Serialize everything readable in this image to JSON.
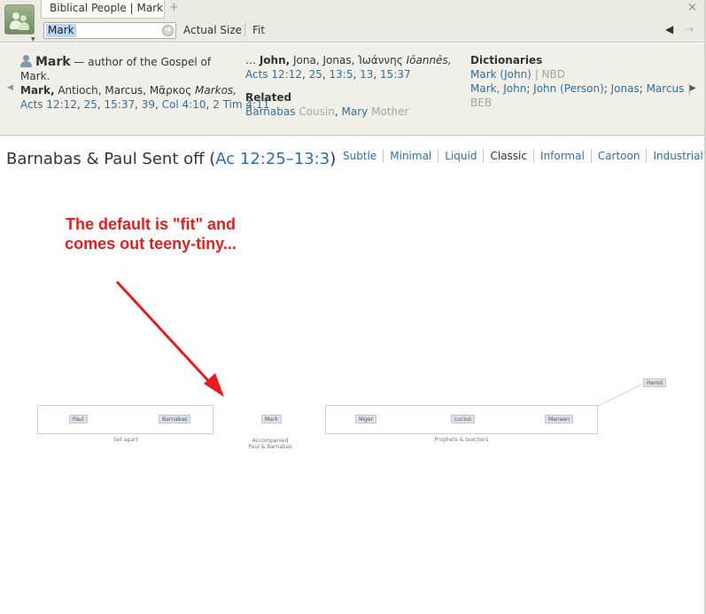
{
  "tab": {
    "title": "Biblical People | Mark",
    "new_tab": "+",
    "close": "×"
  },
  "toolbar": {
    "search_value": "Mark",
    "actual_size_label": "Actual Size",
    "fit_label": "Fit",
    "back_arrow": "◀",
    "forward_arrow": "⇢"
  },
  "info": {
    "name": "Mark",
    "description": "— author of the Gospel of Mark.",
    "alt_names_bold": "Mark,",
    "alt_names_plain": "Antioch, Marcus, Μᾶρκος",
    "alt_names_italic": "Markos,",
    "refs_col1": [
      "Acts 12:12",
      "25",
      "15:37",
      "39",
      "Col 4:10",
      "2 Tim 4:11"
    ],
    "col2_prefix": "…",
    "col2_bold": "John,",
    "col2_plain": "Jona, Jonas, Ἰωάννης",
    "col2_italic": "Iōannēs,",
    "refs_col2": [
      "Acts 12:12",
      "25",
      "13:5",
      "13",
      "15:37"
    ],
    "related_heading": "Related",
    "related": [
      {
        "name": "Barnabas",
        "relation": "Cousin"
      },
      {
        "name": "Mary",
        "relation": "Mother"
      }
    ],
    "dictionaries_heading": "Dictionaries",
    "dictionaries_line1": {
      "link": "Mark (John)",
      "muted": "| NBD"
    },
    "dictionaries_line2": [
      "Mark, John",
      "John (Person)",
      "Jonas",
      "Marcus"
    ],
    "dictionaries_line2_sep": "|",
    "dictionaries_line3_muted": "BEB"
  },
  "main": {
    "title_prefix": "Barnabas & Paul Sent off (",
    "title_ref": "Ac 12:25–13:3",
    "title_suffix": ")",
    "styles": [
      "Subtle",
      "Minimal",
      "Liquid",
      "Classic",
      "Informal",
      "Cartoon",
      "Industrial"
    ],
    "active_style": "Classic"
  },
  "annotation": {
    "line1": "The default is \"fit\" and",
    "line2": "comes out teeny-tiny...",
    "color": "#e41e1e"
  },
  "diagram": {
    "group1": {
      "nodes": [
        "Paul",
        "Barnabas"
      ],
      "caption": "Set apart"
    },
    "mark": {
      "node": "Mark",
      "caption_line1": "Accompanied",
      "caption_line2": "Paul & Barnabas"
    },
    "group2": {
      "nodes": [
        "Niger",
        "Lucius",
        "Manaen"
      ],
      "caption": "Prophets & teachers"
    },
    "herod": "Herod"
  }
}
